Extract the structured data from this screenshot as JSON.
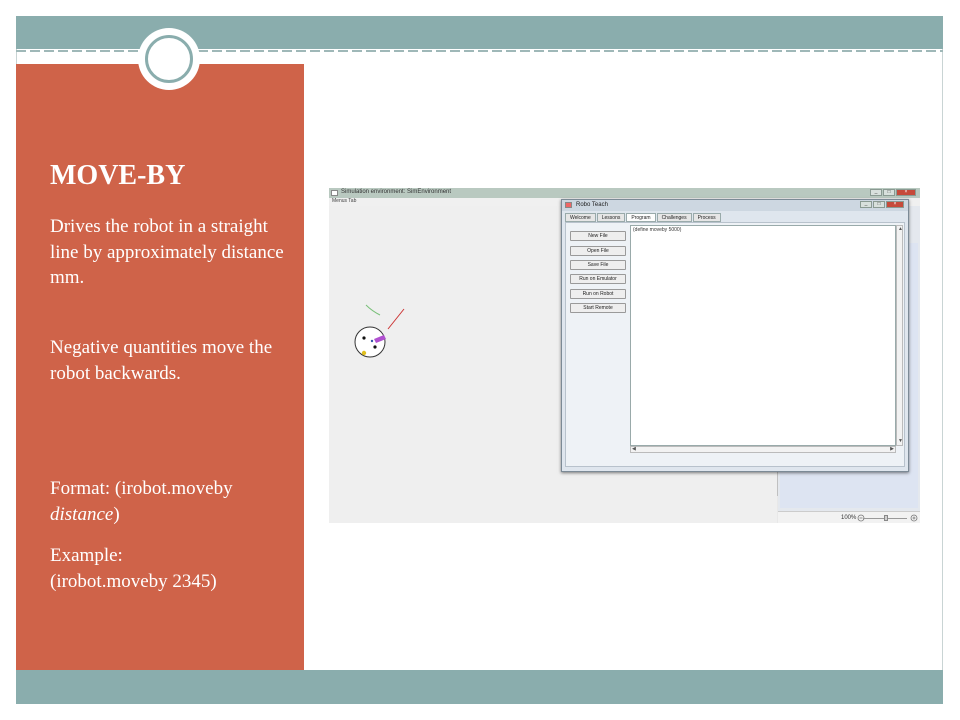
{
  "slide": {
    "title": "MOVE-BY",
    "paragraph1": "Drives the robot in a straight line by approximately distance mm.",
    "paragraph2": "Negative quantities move the robot backwards.",
    "format_prefix": "Format: (irobot.moveby",
    "format_arg": "distance",
    "format_suffix": ")",
    "example_label": "Example:",
    "example_code": "(irobot.moveby 2345)",
    "colors": {
      "accent_panel": "#cf6349",
      "band": "#8aadad"
    }
  },
  "screenshot": {
    "sim_window": {
      "title": "Simulation environment: SimEnvironment",
      "menu": "Menus   Tab",
      "window_buttons": [
        "_",
        "□",
        "×"
      ]
    },
    "robo_window": {
      "title": "Robo Teach",
      "window_buttons": [
        "_",
        "□",
        "×"
      ],
      "tabs": [
        {
          "label": "Welcome",
          "active": false
        },
        {
          "label": "Lessons",
          "active": false
        },
        {
          "label": "Program",
          "active": true
        },
        {
          "label": "Challenges",
          "active": false
        },
        {
          "label": "Process",
          "active": false
        }
      ],
      "buttons": [
        "New File",
        "Open File",
        "Save File",
        "Run on Emulator",
        "Run on Robot",
        "Start Remote"
      ],
      "editor_text": "(define moveby 5000)"
    },
    "status": {
      "zoom": "100%"
    },
    "icons": [
      "robot-icon",
      "sensor-icon",
      "zoom-out-icon",
      "zoom-in-icon"
    ]
  }
}
